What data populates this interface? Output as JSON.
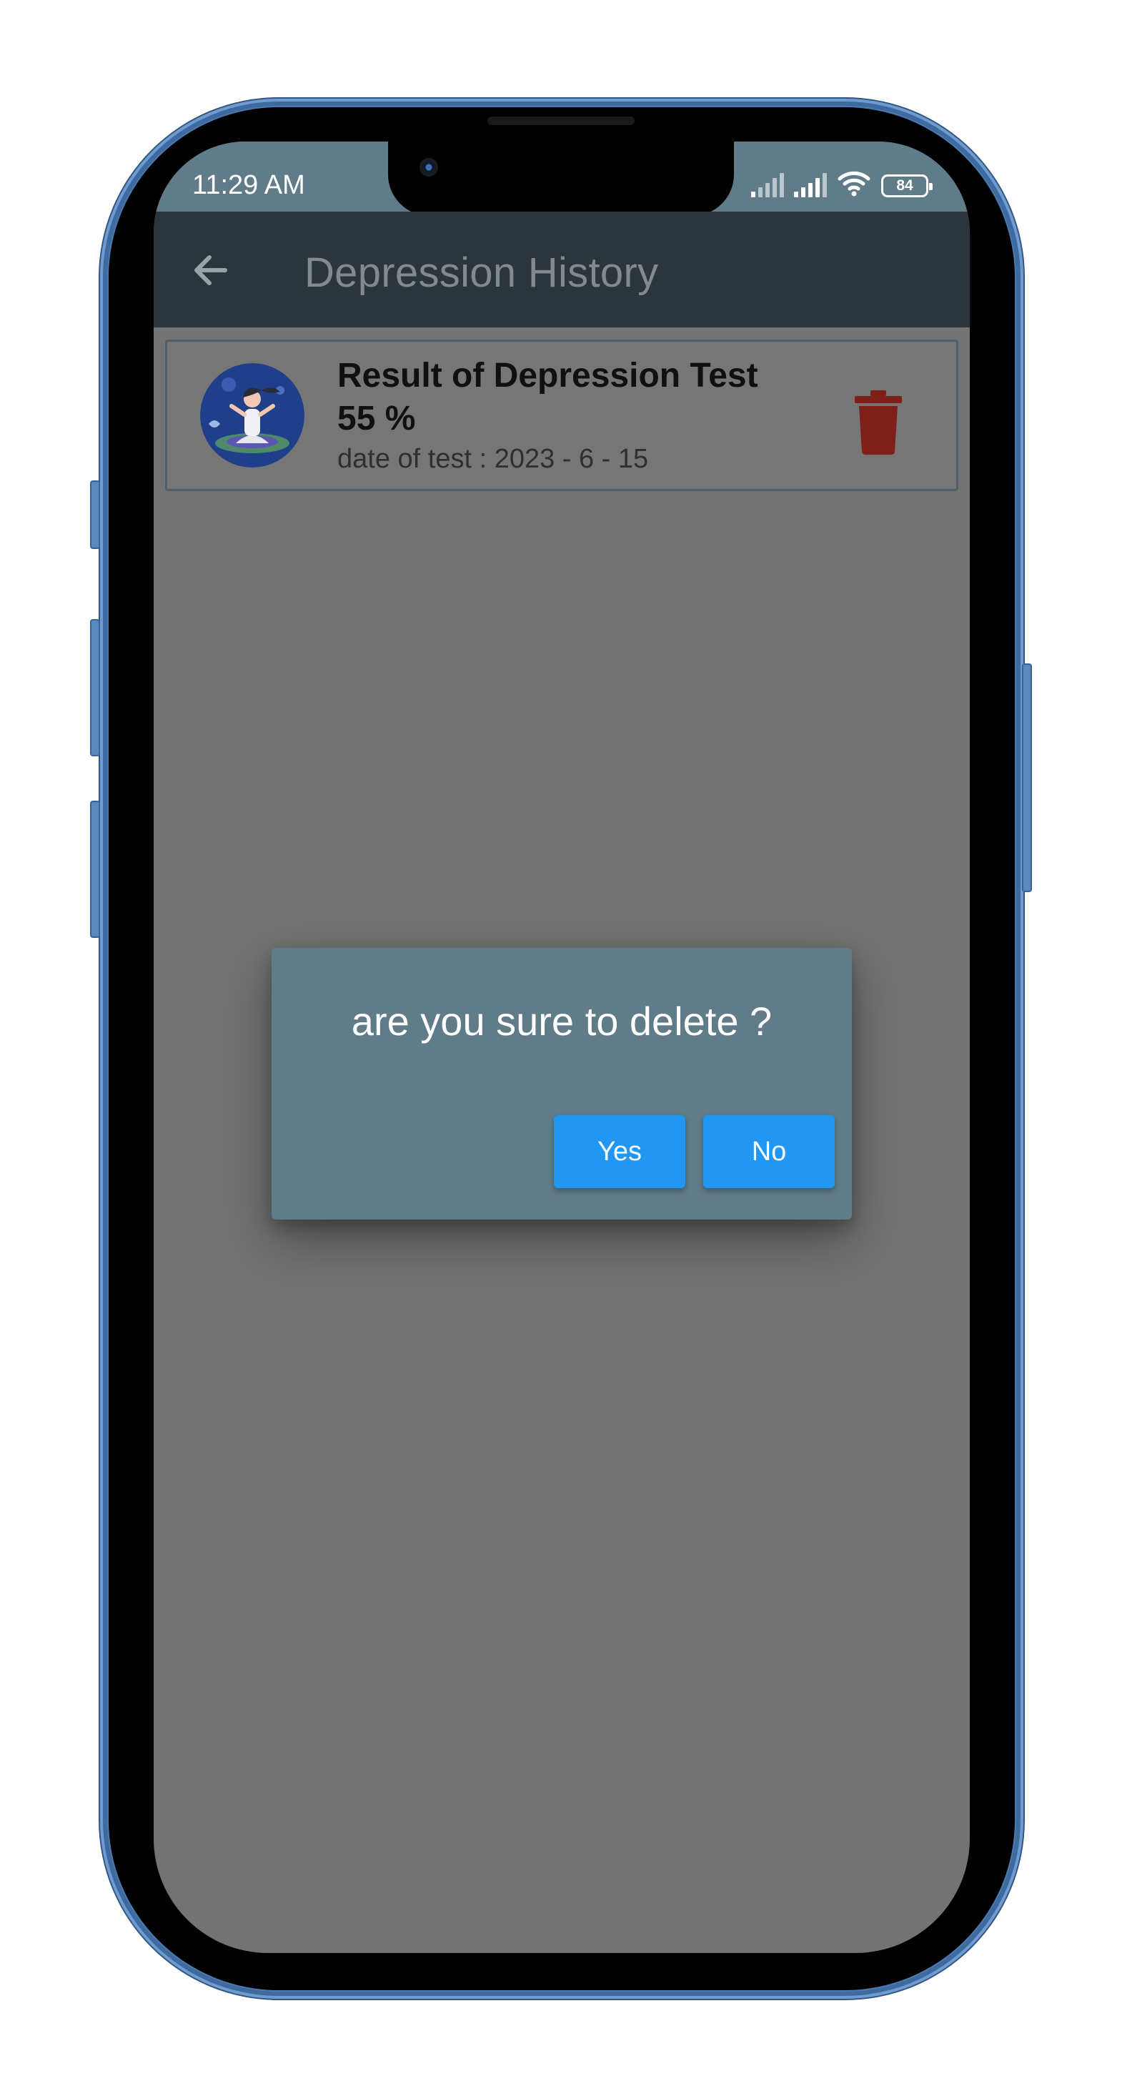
{
  "status_bar": {
    "time": "11:29 AM",
    "battery_level": "84",
    "icons": [
      "signal-icon",
      "signal-icon",
      "wifi-icon",
      "battery-icon"
    ]
  },
  "app_bar": {
    "title": "Depression History",
    "back_icon": "arrow-left-icon"
  },
  "history": {
    "items": [
      {
        "title": "Result of Depression Test",
        "percent": "55 %",
        "date": "date of test : 2023 - 6 - 15",
        "avatar_icon": "meditation-avatar",
        "delete_icon": "trash-icon"
      }
    ]
  },
  "dialog": {
    "message": "are you sure to delete ?",
    "yes_label": "Yes",
    "no_label": "No"
  },
  "colors": {
    "status_bar": "#617c89",
    "app_bar": "#2b363c",
    "scrim_background": "#737373",
    "dialog_background": "#617c89",
    "button": "#2196f3",
    "delete_icon": "#7f1f1a",
    "phone_frame": "#4a7ab0"
  }
}
